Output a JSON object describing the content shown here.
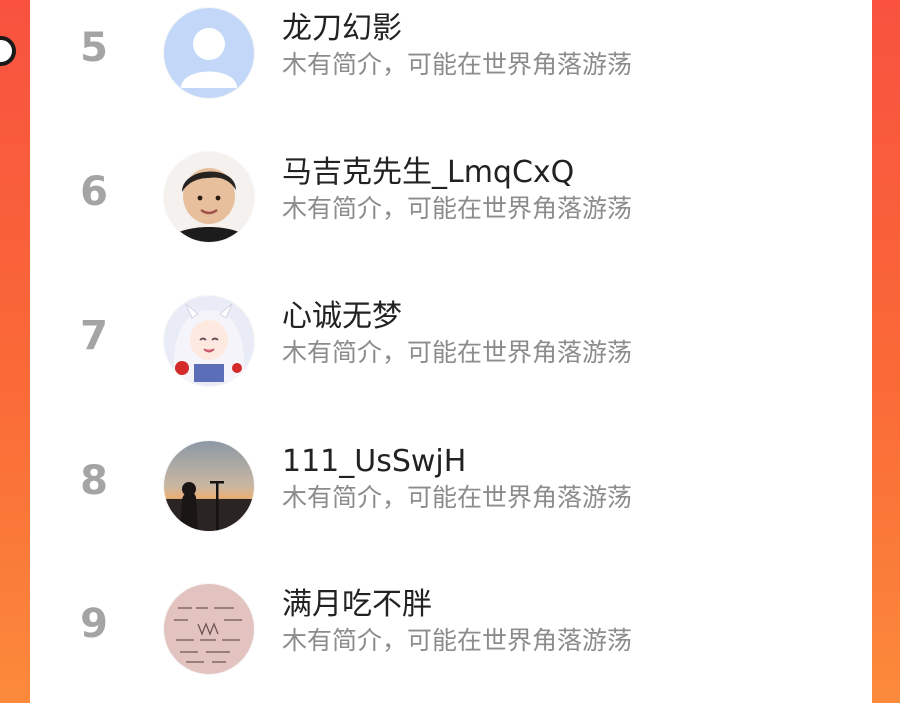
{
  "ranking": {
    "items": [
      {
        "rank": "5",
        "name": "龙刀幻影",
        "bio": "木有简介，可能在世界角落游荡",
        "avatar_icon": "default-user-avatar-icon"
      },
      {
        "rank": "6",
        "name": "马吉克先生_LmqCxQ",
        "bio": "木有简介，可能在世界角落游荡",
        "avatar_icon": "boy-photo-avatar-icon"
      },
      {
        "rank": "7",
        "name": "心诚无梦",
        "bio": "木有简介，可能在世界角落游荡",
        "avatar_icon": "anime-girl-avatar-icon"
      },
      {
        "rank": "8",
        "name": "111_UsSwjH",
        "bio": "木有简介，可能在世界角落游荡",
        "avatar_icon": "sunset-photo-avatar-icon"
      },
      {
        "rank": "9",
        "name": "满月吃不胖",
        "bio": "木有简介，可能在世界角落游荡",
        "avatar_icon": "handwriting-avatar-icon"
      }
    ]
  },
  "colors": {
    "background_orange": "#f8523f",
    "rank_number": "#a4a4a4",
    "name_text": "#222222",
    "bio_text": "#8c8c8c"
  }
}
